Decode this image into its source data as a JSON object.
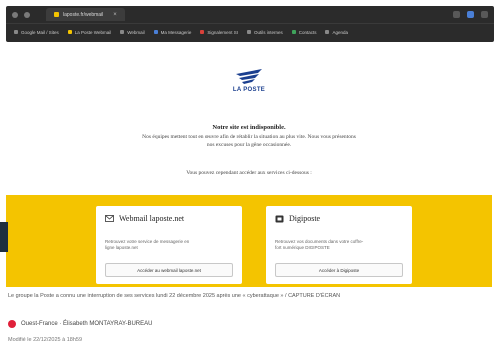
{
  "browser": {
    "tab_title": "laposte.fr/webmail",
    "bookmarks": [
      {
        "label": "Google Mail / Sites",
        "icon": "bookmark-icon",
        "color": "#888888"
      },
      {
        "label": "La Poste Webmail",
        "icon": "bookmark-icon",
        "color": "#f4c400"
      },
      {
        "label": "Webmail",
        "icon": "bookmark-icon",
        "color": "#888888"
      },
      {
        "label": "Ma Messagerie",
        "icon": "bookmark-icon",
        "color": "#4a7fd6"
      },
      {
        "label": "Signalement SI",
        "icon": "bookmark-icon",
        "color": "#d9413a"
      },
      {
        "label": "Outils internes",
        "icon": "bookmark-icon",
        "color": "#888888"
      },
      {
        "label": "Contacts",
        "icon": "bookmark-icon",
        "color": "#3fa35b"
      },
      {
        "label": "Agenda",
        "icon": "bookmark-icon",
        "color": "#888888"
      }
    ]
  },
  "logo": {
    "text": "LA POSTE",
    "color": "#1b3f8f"
  },
  "notice": {
    "title": "Notre site est indisponible.",
    "body_line1": "Nos équipes mettent tout en œuvre afin de rétablir la situation au plus vite. Nous vous présentons",
    "body_line2": "nos excuses pour la gêne occasionnée.",
    "cta": "Vous pouvez cependant accéder aux services ci-dessous :"
  },
  "cards": {
    "webmail": {
      "title": "Webmail laposte.net",
      "desc_line1": "Retrouvez votre service de messagerie en",
      "desc_line2": "ligne laposte.net",
      "button": "Accéder au webmail laposte.net"
    },
    "digiposte": {
      "title": "Digiposte",
      "desc_line1": "Retrouvez vos documents dans votre coffre-",
      "desc_line2": "fort numérique DIGIPOSTE",
      "button": "Accéder à Digiposte"
    }
  },
  "announcement": "Le groupe la Poste a connu une interruption de ses services lundi 22 décembre 2025 après une « cyberattaque » / CAPTURE D'ÉCRAN",
  "author": "Ouest-France · Élisabeth MONTAYRAY-BUREAU",
  "modified": "Modifié le 22/12/2025 à 18h59",
  "colors": {
    "brand_yellow": "#f4c400",
    "brand_blue": "#1b3f8f",
    "author_red": "#e0203a"
  }
}
